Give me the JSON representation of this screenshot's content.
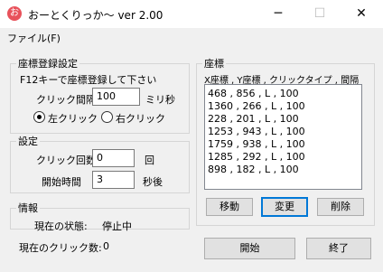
{
  "window": {
    "icon_glyph": "お",
    "title": "おーとくりっか～ ver 2.00",
    "minimize_glyph": "─",
    "maximize_glyph": "☐",
    "close_glyph": "✕"
  },
  "menu": {
    "file_label": "ファイル(F)"
  },
  "coord_setting": {
    "legend": "座標登録設定",
    "hint": "F12キーで座標登録して下さい",
    "interval_label": "クリック間隔",
    "interval_value": "100",
    "interval_unit": "ミリ秒",
    "left_click_label": "左クリック",
    "right_click_label": "右クリック",
    "selected_click": "left"
  },
  "settings": {
    "legend": "設定",
    "count_label": "クリック回数",
    "count_value": "0",
    "count_unit": "回",
    "start_label": "開始時間",
    "start_value": "3",
    "start_unit": "秒後"
  },
  "info": {
    "legend": "情報",
    "state_label": "現在の状態:",
    "state_value": "停止中",
    "clicks_label": "現在のクリック数:",
    "clicks_value": "0"
  },
  "coords": {
    "legend": "座標",
    "header": "X座標 , Y座標 , クリックタイプ , 間隔",
    "items": [
      "468 , 856 , L , 100",
      "1360 , 266 , L , 100",
      "228 , 201 , L , 100",
      "1253 , 943 , L , 100",
      "1759 , 938 , L , 100",
      "1285 , 292 , L , 100",
      "898 , 182 , L , 100"
    ],
    "move_label": "移動",
    "change_label": "変更",
    "delete_label": "削除"
  },
  "actions": {
    "start_label": "開始",
    "end_label": "終了"
  }
}
